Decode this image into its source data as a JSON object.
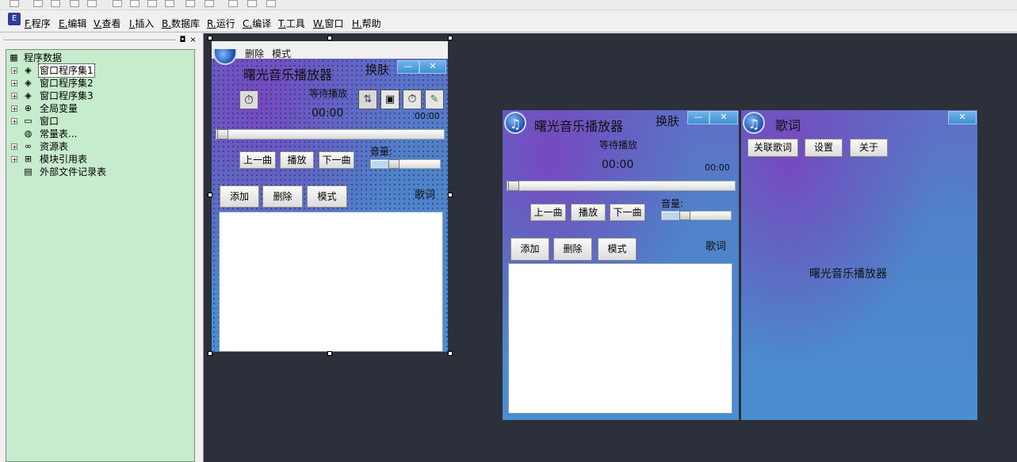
{
  "menu": {
    "items": [
      {
        "key": "F.",
        "label": "程序"
      },
      {
        "key": "E.",
        "label": "编辑"
      },
      {
        "key": "V.",
        "label": "查看"
      },
      {
        "key": "I.",
        "label": "插入"
      },
      {
        "key": "B.",
        "label": "数据库"
      },
      {
        "key": "R.",
        "label": "运行"
      },
      {
        "key": "C.",
        "label": "编译"
      },
      {
        "key": "T.",
        "label": "工具"
      },
      {
        "key": "W.",
        "label": "窗口"
      },
      {
        "key": "H.",
        "label": "帮助"
      }
    ]
  },
  "panel": {
    "pin_glyph": "◘",
    "close_glyph": "×"
  },
  "tree": {
    "root": "程序数据",
    "items": [
      {
        "label": "窗口程序集1",
        "icon": "layers-icon",
        "glyph": "◈",
        "selected": true
      },
      {
        "label": "窗口程序集2",
        "icon": "layers-icon",
        "glyph": "◈"
      },
      {
        "label": "窗口程序集3",
        "icon": "layers-icon",
        "glyph": "◈"
      },
      {
        "label": "全局变量",
        "icon": "lock-icon",
        "glyph": "⊕"
      },
      {
        "label": "窗口",
        "icon": "window-icon",
        "glyph": "▭"
      },
      {
        "label": "常量表...",
        "icon": "constants-icon",
        "glyph": "◍"
      },
      {
        "label": "资源表",
        "icon": "resource-icon",
        "glyph": "∞"
      },
      {
        "label": "模块引用表",
        "icon": "module-icon",
        "glyph": "⊞"
      },
      {
        "label": "外部文件记录表",
        "icon": "file-icon",
        "glyph": "▤"
      }
    ]
  },
  "designer": {
    "menu": [
      "添加",
      "删除",
      "模式"
    ],
    "title": "曙光音乐播放器",
    "skin": "换肤",
    "status": "等待播放",
    "time": "00:00",
    "time_small": "00:00",
    "volume_label": "音量:",
    "lyrics_label": "歌词",
    "buttons": {
      "prev": "上一曲",
      "play": "播放",
      "next": "下一曲",
      "add": "添加",
      "delete": "删除",
      "mode": "模式"
    },
    "win_min": "—",
    "win_close": "✕",
    "volume_level": 0.3
  },
  "preview": {
    "title": "曙光音乐播放器",
    "skin": "换肤",
    "status": "等待播放",
    "time": "00:00",
    "time_small": "00:00",
    "volume_label": "音量:",
    "lyrics_label": "歌词",
    "buttons": {
      "prev": "上一曲",
      "play": "播放",
      "next": "下一曲",
      "add": "添加",
      "delete": "删除",
      "mode": "模式"
    },
    "win_min": "—",
    "win_close": "✕",
    "volume_level": 0.3
  },
  "lyrics_window": {
    "title": "歌词",
    "buttons": {
      "link": "关联歌词",
      "settings": "设置",
      "about": "关于"
    },
    "center_text": "曙光音乐播放器",
    "win_close": "✕"
  },
  "colors": {
    "tree_bg": "#c6ebcd",
    "canvas_bg": "#2b303a",
    "form_blue": "#4a8ed0"
  }
}
